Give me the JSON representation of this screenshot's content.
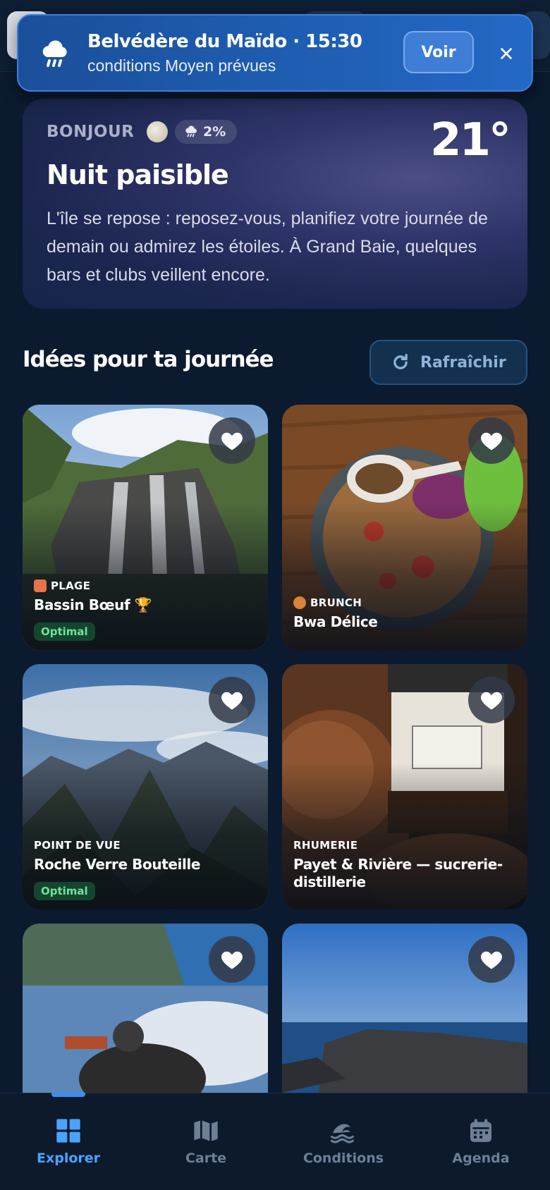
{
  "notification": {
    "title": "Belvédère du Maïdo · 15:30",
    "subtitle": "conditions Moyen prévues",
    "action_label": "Voir",
    "icon": "rain-cloud-icon",
    "close_icon": "close-icon"
  },
  "hero": {
    "greeting": "BONJOUR",
    "rain_chance": "2%",
    "temperature": "21°",
    "title": "Nuit paisible",
    "description": "L'île se repose : reposez-vous, planifiez votre journée de demain ou admirez les étoiles. À Grand Baie, quelques bars et clubs veillent encore."
  },
  "section": {
    "title": "Idées pour ta journée",
    "refresh_label": "Rafraîchir"
  },
  "cards": [
    {
      "category": "PLAGE",
      "name": "Bassin Bœuf 🏆",
      "badge": "Optimal",
      "favorited": true
    },
    {
      "category": "BRUNCH",
      "name": "Bwa Délice",
      "badge": "",
      "favorited": true
    },
    {
      "category": "POINT DE VUE",
      "name": "Roche Verre Bouteille",
      "badge": "Optimal",
      "favorited": true
    },
    {
      "category": "RHUMERIE",
      "name": "Payet & Rivière — sucrerie-distillerie",
      "badge": "",
      "favorited": true
    },
    {
      "category": "",
      "name": "",
      "badge": "",
      "favorited": true
    },
    {
      "category": "",
      "name": "",
      "badge": "",
      "favorited": true
    }
  ],
  "nav": {
    "items": [
      {
        "label": "Explorer",
        "icon": "grid-icon",
        "active": true
      },
      {
        "label": "Carte",
        "icon": "map-icon",
        "active": false
      },
      {
        "label": "Conditions",
        "icon": "wave-icon",
        "active": false
      },
      {
        "label": "Agenda",
        "icon": "calendar-icon",
        "active": false
      }
    ]
  },
  "colors": {
    "background": "#0b1a2e",
    "accent": "#4aa3ff",
    "notification": "#1f5fb4",
    "optimal_badge": "#6fe39b"
  }
}
